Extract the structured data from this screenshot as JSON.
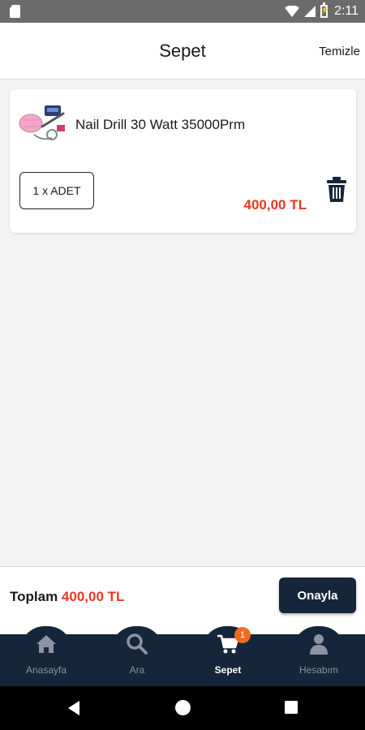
{
  "status_bar": {
    "time": "2:11",
    "icons": [
      "sd-card-icon",
      "wifi-icon",
      "signal-icon",
      "battery-charging-icon"
    ]
  },
  "header": {
    "title": "Sepet",
    "clear_label": "Temizle"
  },
  "cart": {
    "items": [
      {
        "name": "Nail Drill 30 Watt 35000Prm",
        "quantity": "1 x ADET",
        "price": "400,00 TL",
        "thumbnail_icon": "nail-drill-product-image"
      }
    ]
  },
  "summary": {
    "total_label": "Toplam",
    "total_value": "400,00 TL",
    "confirm_label": "Onayla"
  },
  "bottom_nav": {
    "items": [
      {
        "label": "Anasayfa",
        "icon": "home-icon"
      },
      {
        "label": "Ara",
        "icon": "search-icon"
      },
      {
        "label": "Sepet",
        "icon": "cart-icon",
        "badge": "1",
        "active": true
      },
      {
        "label": "Hesabım",
        "icon": "user-icon"
      }
    ]
  },
  "colors": {
    "accent": "#e8381f",
    "nav_background": "#15263a",
    "badge": "#f26a21"
  }
}
